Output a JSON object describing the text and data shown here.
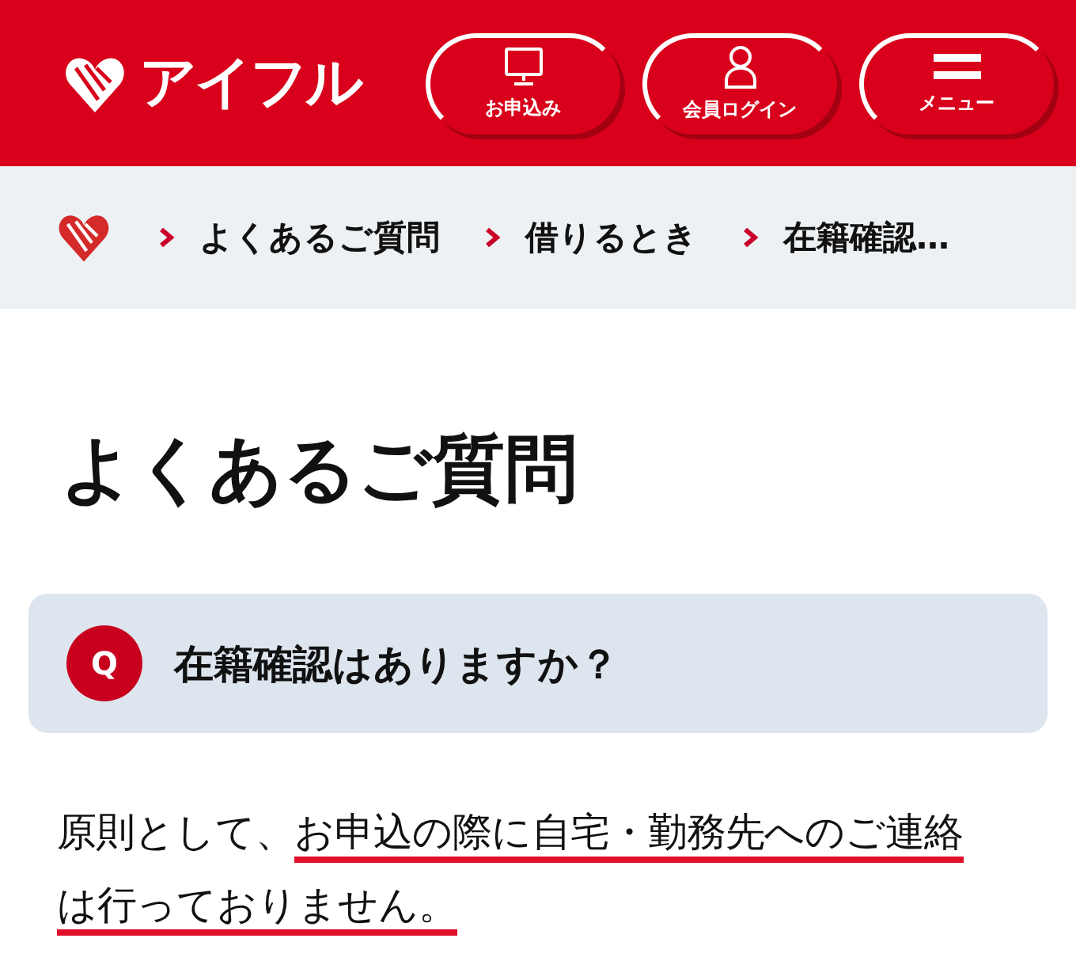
{
  "header": {
    "logo_text": "アイフル",
    "buttons": [
      {
        "kind": "apply",
        "label": "お申込み"
      },
      {
        "kind": "login",
        "label": "会員ログイン"
      },
      {
        "kind": "menu",
        "label": "メニュー"
      }
    ]
  },
  "breadcrumb": [
    "よくあるご質問",
    "借りるとき",
    "在籍確認…"
  ],
  "page_title": "よくあるご質問",
  "question": {
    "badge": "Q",
    "text": "在籍確認はありますか？"
  },
  "answer": {
    "lead": "原則として、",
    "emphasis": "お申込の際に自宅・勤務先へのご連絡は行っておりません。"
  }
}
